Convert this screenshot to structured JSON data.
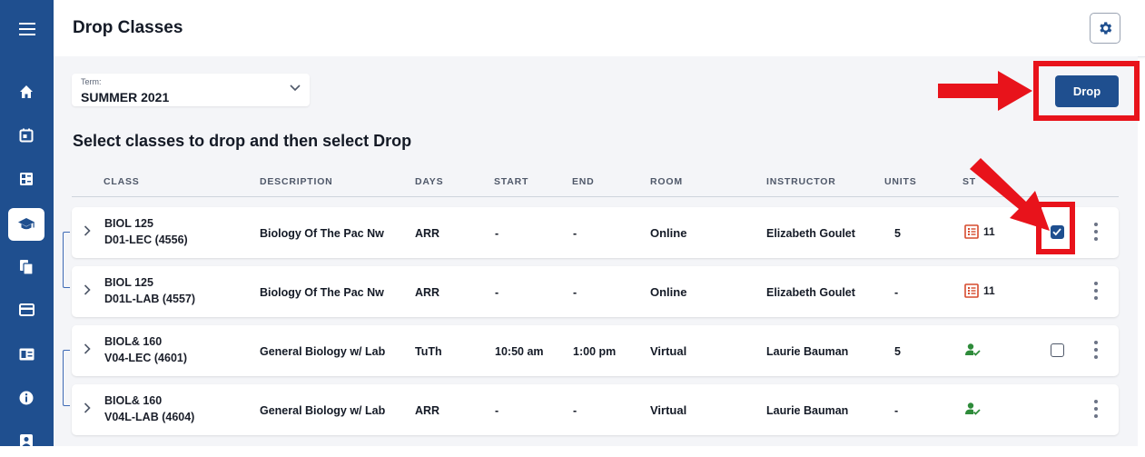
{
  "app": {
    "title": "Drop Classes",
    "accent_color": "#1f4f8f",
    "highlight_color": "#e8131b"
  },
  "sidebar": {
    "items": [
      {
        "icon": "menu-icon"
      },
      {
        "icon": "home-icon"
      },
      {
        "icon": "calendar-icon"
      },
      {
        "icon": "grid-list-icon"
      },
      {
        "icon": "graduation-cap-icon",
        "active": true
      },
      {
        "icon": "documents-icon"
      },
      {
        "icon": "credit-card-icon"
      },
      {
        "icon": "id-card-icon"
      },
      {
        "icon": "info-icon"
      },
      {
        "icon": "user-badge-icon"
      }
    ]
  },
  "header": {
    "settings_icon": "gear-icon"
  },
  "term": {
    "label": "Term:",
    "value": "SUMMER 2021"
  },
  "actions": {
    "drop_label": "Drop"
  },
  "instructions": "Select classes to drop and then select Drop",
  "table": {
    "columns": [
      "CLASS",
      "DESCRIPTION",
      "DAYS",
      "START",
      "END",
      "ROOM",
      "INSTRUCTOR",
      "UNITS",
      "ST"
    ],
    "rows": [
      {
        "class_code": "BIOL 125",
        "section": "D01-LEC (4556)",
        "description": "Biology Of The Pac Nw",
        "days": "ARR",
        "start": "-",
        "end": "-",
        "room": "Online",
        "instructor": "Elizabeth Goulet",
        "units": "5",
        "status_icon": "waitlist-icon",
        "status_text": "11",
        "checkbox": "checked"
      },
      {
        "class_code": "BIOL 125",
        "section": "D01L-LAB (4557)",
        "description": "Biology Of The Pac Nw",
        "days": "ARR",
        "start": "-",
        "end": "-",
        "room": "Online",
        "instructor": "Elizabeth Goulet",
        "units": "-",
        "status_icon": "waitlist-icon",
        "status_text": "11",
        "checkbox": "none"
      },
      {
        "class_code": "BIOL& 160",
        "section": "V04-LEC (4601)",
        "description": "General Biology w/ Lab",
        "days": "TuTh",
        "start": "10:50 am",
        "end": "1:00 pm",
        "room": "Virtual",
        "instructor": "Laurie Bauman",
        "units": "5",
        "status_icon": "enrolled-icon",
        "status_text": "",
        "checkbox": "unchecked"
      },
      {
        "class_code": "BIOL& 160",
        "section": "V04L-LAB (4604)",
        "description": "General Biology w/ Lab",
        "days": "ARR",
        "start": "-",
        "end": "-",
        "room": "Virtual",
        "instructor": "Laurie Bauman",
        "units": "-",
        "status_icon": "enrolled-icon",
        "status_text": "",
        "checkbox": "none"
      }
    ]
  }
}
